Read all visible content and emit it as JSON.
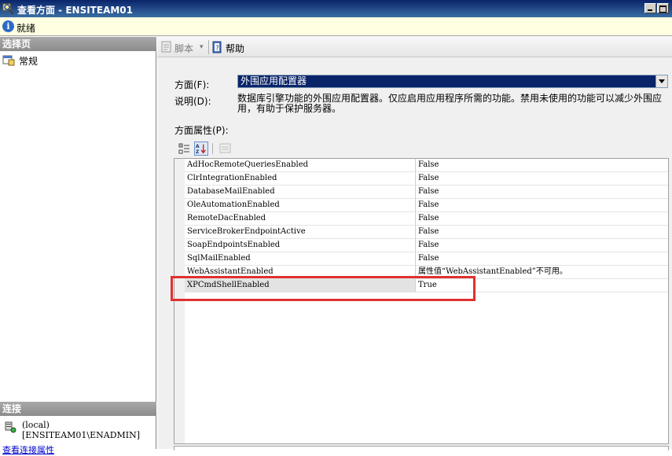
{
  "window": {
    "title": "查看方面 - ENSITEAM01"
  },
  "status": {
    "text": "就绪"
  },
  "left_pane": {
    "select_page_header": "选择页",
    "pages": [
      {
        "label": "常规"
      }
    ],
    "connection_header": "连接",
    "connection": {
      "server": "(local)",
      "user": "[ENSITEAM01\\ENADMIN]",
      "link": "查看连接属性"
    }
  },
  "toolbar": {
    "script_label": "脚本",
    "help_label": "帮助"
  },
  "facet": {
    "label": "方面(F):",
    "value": "外围应用配置器",
    "description_label": "说明(D):",
    "description": "数据库引擎功能的外围应用配置器。仅应启用应用程序所需的功能。禁用未使用的功能可以减少外围应用，有助于保护服务器。",
    "properties_label": "方面属性(P):"
  },
  "properties": [
    {
      "name": "AdHocRemoteQueriesEnabled",
      "value": "False"
    },
    {
      "name": "ClrIntegrationEnabled",
      "value": "False"
    },
    {
      "name": "DatabaseMailEnabled",
      "value": "False"
    },
    {
      "name": "OleAutomationEnabled",
      "value": "False"
    },
    {
      "name": "RemoteDacEnabled",
      "value": "False"
    },
    {
      "name": "ServiceBrokerEndpointActive",
      "value": "False"
    },
    {
      "name": "SoapEndpointsEnabled",
      "value": "False"
    },
    {
      "name": "SqlMailEnabled",
      "value": "False"
    },
    {
      "name": "WebAssistantEnabled",
      "value": "属性值“WebAssistantEnabled”不可用。"
    },
    {
      "name": "XPCmdShellEnabled",
      "value": "True"
    }
  ],
  "colors": {
    "titlebar": "#0a246a",
    "highlight_box": "#e03030",
    "selected_facet_bg": "#0a246a"
  }
}
